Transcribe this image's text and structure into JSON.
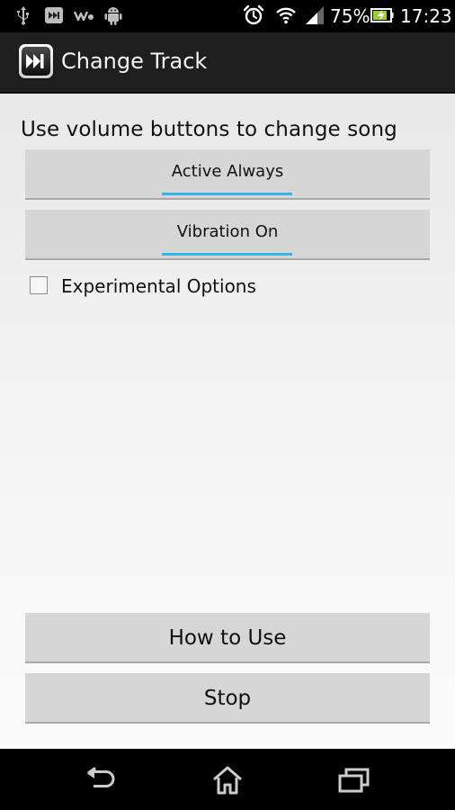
{
  "status_bar": {
    "battery_percent": "75%",
    "time": "17:23",
    "icons": [
      "usb-icon",
      "media-skip-icon",
      "walkman-icon",
      "android-debug-icon",
      "alarm-icon",
      "wifi-icon",
      "signal-icon",
      "battery-charging-icon"
    ]
  },
  "action_bar": {
    "title": "Change Track",
    "app_icon": "fast-forward-icon"
  },
  "main": {
    "subtitle": "Use volume buttons to change song",
    "toggle_active": {
      "label": "Active Always",
      "checked": true
    },
    "toggle_vibration": {
      "label": "Vibration On",
      "checked": true
    },
    "experimental": {
      "label": "Experimental Options",
      "checked": false
    },
    "how_to_use_label": "How to Use",
    "stop_label": "Stop"
  },
  "nav_bar": {
    "buttons": [
      "back-icon",
      "home-icon",
      "recent-apps-icon"
    ]
  },
  "colors": {
    "accent": "#33b5e5",
    "action_bar": "#1f1f1f",
    "button": "#d6d6d6"
  }
}
